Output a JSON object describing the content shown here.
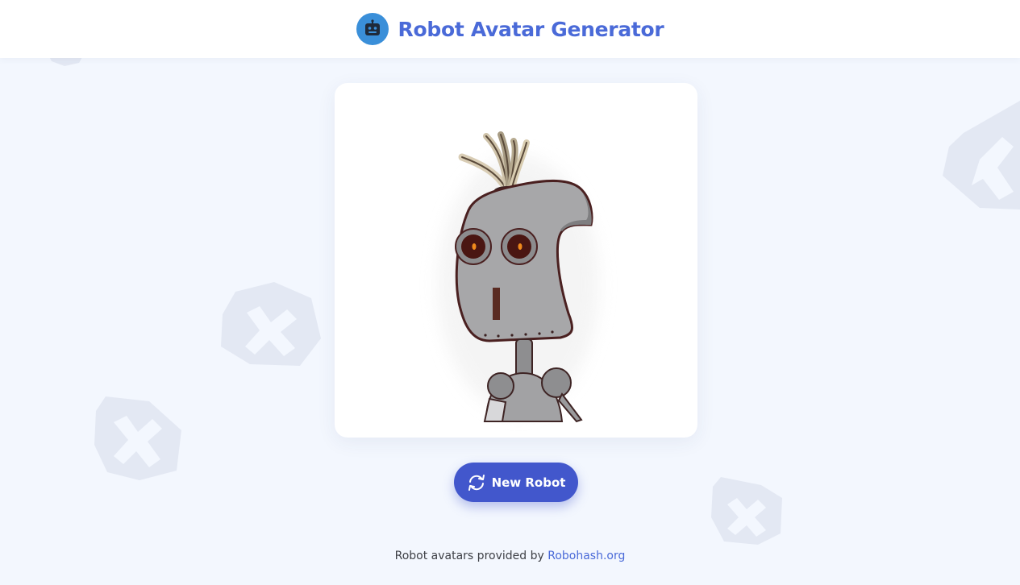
{
  "header": {
    "title": "Robot Avatar Generator",
    "logo_icon": "robot-face-icon"
  },
  "main": {
    "avatar_image_icon": "robot-avatar-image",
    "new_button": {
      "label": "New Robot",
      "icon": "refresh-icon"
    }
  },
  "footer": {
    "prefix": "Robot avatars provided by",
    "link_text": "Robohash.org"
  },
  "colors": {
    "background": "#f3f7fe",
    "brand": "#4a6ad8",
    "button": "#4257cc",
    "logo_bg": "#3a8fd9",
    "decor_shape": "#e3e8f3"
  }
}
